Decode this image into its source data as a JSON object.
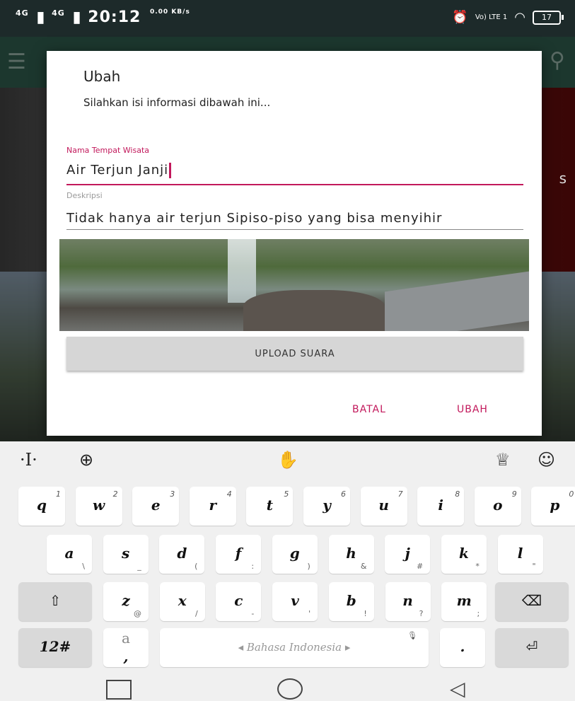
{
  "status_bar": {
    "network1": "4G",
    "network2": "4G",
    "time": "20:12",
    "speed": "0.00 KB/s",
    "lte": "Vo) LTE 1",
    "battery": "17"
  },
  "dialog": {
    "title": "Ubah",
    "subtitle": "Silahkan isi informasi dibawah ini...",
    "fields": {
      "name_label": "Nama Tempat Wisata",
      "name_value": "Air Terjun Janji",
      "desc_label": "Deskripsi",
      "desc_value": "Tidak hanya air terjun Sipiso-piso yang bisa menyihir"
    },
    "upload_button": "UPLOAD SUARA",
    "cancel_button": "BATAL",
    "submit_button": "UBAH"
  },
  "background": {
    "partial_text": "s"
  },
  "keyboard": {
    "space_label": "Bahasa Indonesia",
    "numbers_key": "12#",
    "period_key": ".",
    "comma_key_top": "a",
    "comma_key_bottom": ",",
    "row1": [
      {
        "k": "q",
        "s": "1"
      },
      {
        "k": "w",
        "s": "2"
      },
      {
        "k": "e",
        "s": "3"
      },
      {
        "k": "r",
        "s": "4"
      },
      {
        "k": "t",
        "s": "5"
      },
      {
        "k": "y",
        "s": "6"
      },
      {
        "k": "u",
        "s": "7"
      },
      {
        "k": "i",
        "s": "8"
      },
      {
        "k": "o",
        "s": "9"
      },
      {
        "k": "p",
        "s": "0"
      }
    ],
    "row2": [
      {
        "k": "a",
        "s": "\\"
      },
      {
        "k": "s",
        "s": "_"
      },
      {
        "k": "d",
        "s": "("
      },
      {
        "k": "f",
        "s": ":"
      },
      {
        "k": "g",
        "s": ")"
      },
      {
        "k": "h",
        "s": "&"
      },
      {
        "k": "j",
        "s": "#"
      },
      {
        "k": "k",
        "s": "*"
      },
      {
        "k": "l",
        "s": "\""
      }
    ],
    "row3": [
      {
        "k": "z",
        "s": "@"
      },
      {
        "k": "x",
        "s": "/"
      },
      {
        "k": "c",
        "s": "-"
      },
      {
        "k": "v",
        "s": "'"
      },
      {
        "k": "b",
        "s": "!"
      },
      {
        "k": "n",
        "s": "?"
      },
      {
        "k": "m",
        "s": ";"
      }
    ]
  },
  "icons": {
    "toolbar": [
      "text-cursor-icon",
      "globe-icon",
      "gesture-icon",
      "shirt-icon",
      "emoji-icon"
    ]
  }
}
